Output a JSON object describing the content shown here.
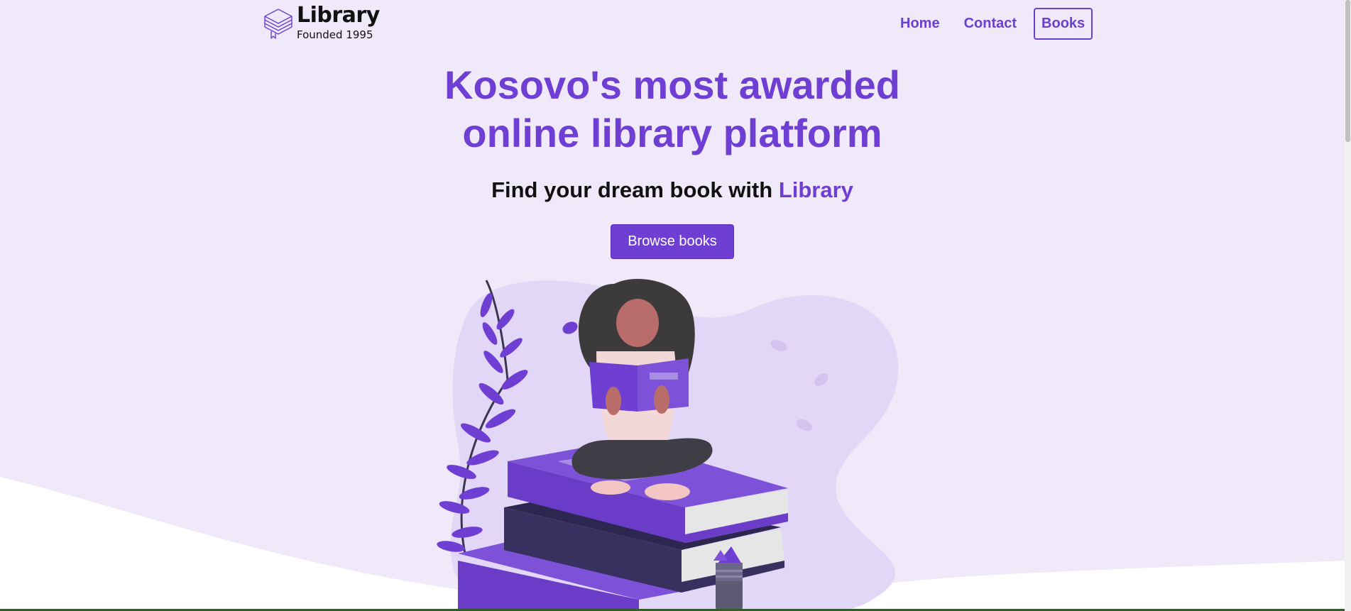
{
  "brand": {
    "title": "Library",
    "subtitle": "Founded 1995"
  },
  "nav": {
    "home": "Home",
    "contact": "Contact",
    "books": "Books"
  },
  "hero": {
    "title_line1": "Kosovo's most awarded",
    "title_line2": "online library platform",
    "subtitle_prefix": "Find your dream book with ",
    "subtitle_accent": "Library",
    "cta_label": "Browse books"
  },
  "colors": {
    "accent": "#6f3fd4",
    "background": "#efe9f9",
    "text": "#111111"
  },
  "icons": {
    "logo": "stacked-books-icon"
  }
}
